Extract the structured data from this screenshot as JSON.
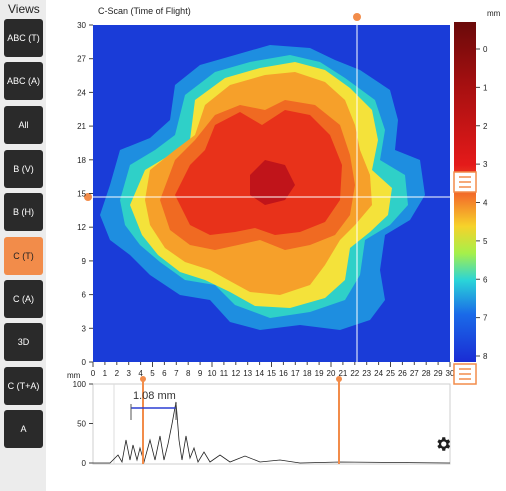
{
  "views": {
    "title": "Views",
    "buttons": [
      "ABC (T)",
      "ABC (A)",
      "All",
      "B (V)",
      "B (H)",
      "C (T)",
      "C (A)",
      "3D",
      "C (T+A)",
      "A"
    ],
    "active": "C (T)"
  },
  "cscan": {
    "title": "C-Scan (Time of Flight)",
    "x_unit": "mm",
    "x_ticks": [
      "0",
      "1",
      "2",
      "3",
      "4",
      "5",
      "6",
      "7",
      "8",
      "9",
      "10",
      "11",
      "12",
      "13",
      "14",
      "15",
      "16",
      "17",
      "18",
      "19",
      "20",
      "21",
      "22",
      "23",
      "24",
      "25",
      "26",
      "27",
      "28",
      "29",
      "30"
    ],
    "y_ticks": [
      "30",
      "27",
      "24",
      "21",
      "18",
      "15",
      "12",
      "9",
      "6",
      "3",
      "0"
    ]
  },
  "colorbar": {
    "unit": "mm",
    "ticks": [
      "0",
      "1",
      "2",
      "3",
      "4",
      "5",
      "6",
      "7",
      "8"
    ]
  },
  "ascan": {
    "y_ticks": [
      "100",
      "50",
      "0"
    ],
    "measurement": "1.08 mm"
  },
  "colors": {
    "accent": "#f28c4a",
    "sidebar_bg": "#ececec",
    "button_bg": "#2a2a2a"
  },
  "icons": {
    "settings": "gear-icon",
    "slider_handle": "menu-lines-icon"
  }
}
